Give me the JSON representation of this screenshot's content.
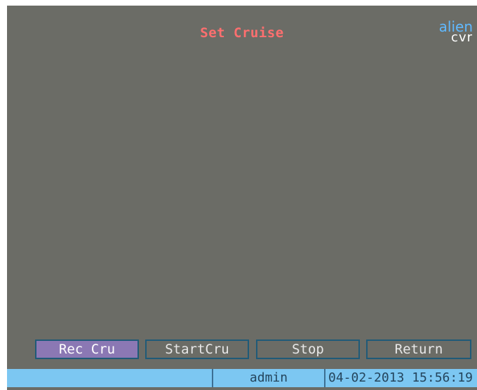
{
  "screen": {
    "title": "Set Cruise",
    "logo_line1": "alien",
    "logo_line2": "cvr",
    "accent_color": "#ff6f6f"
  },
  "buttons": {
    "rec_cru": "Rec Cru",
    "start_cru": "StartCru",
    "stop": "Stop",
    "return": "Return"
  },
  "status": {
    "user": "admin",
    "datetime": "04-02-2013 15:56:19"
  }
}
